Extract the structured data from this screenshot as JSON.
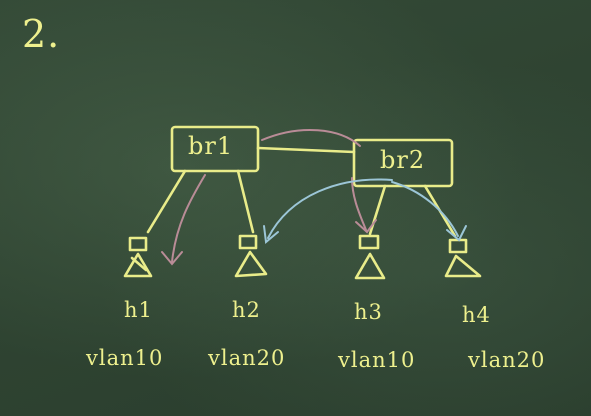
{
  "problem_number": "2.",
  "switches": [
    {
      "id": "br1",
      "label": "br1"
    },
    {
      "id": "br2",
      "label": "br2"
    }
  ],
  "hosts": [
    {
      "id": "h1",
      "label": "h1",
      "vlan": "vlan10"
    },
    {
      "id": "h2",
      "label": "h2",
      "vlan": "vlan20"
    },
    {
      "id": "h3",
      "label": "h3",
      "vlan": "vlan10"
    },
    {
      "id": "h4",
      "label": "h4",
      "vlan": "vlan20"
    }
  ],
  "links": [
    {
      "from": "br1",
      "to": "br2"
    },
    {
      "from": "br1",
      "to": "h1"
    },
    {
      "from": "br1",
      "to": "h2"
    },
    {
      "from": "br2",
      "to": "h3"
    },
    {
      "from": "br2",
      "to": "h4"
    }
  ],
  "colors": {
    "board": "#2f4432",
    "chalk": "#e9ec8a",
    "arrow_red": "#b98c97",
    "arrow_blue": "#9cc6d7"
  }
}
